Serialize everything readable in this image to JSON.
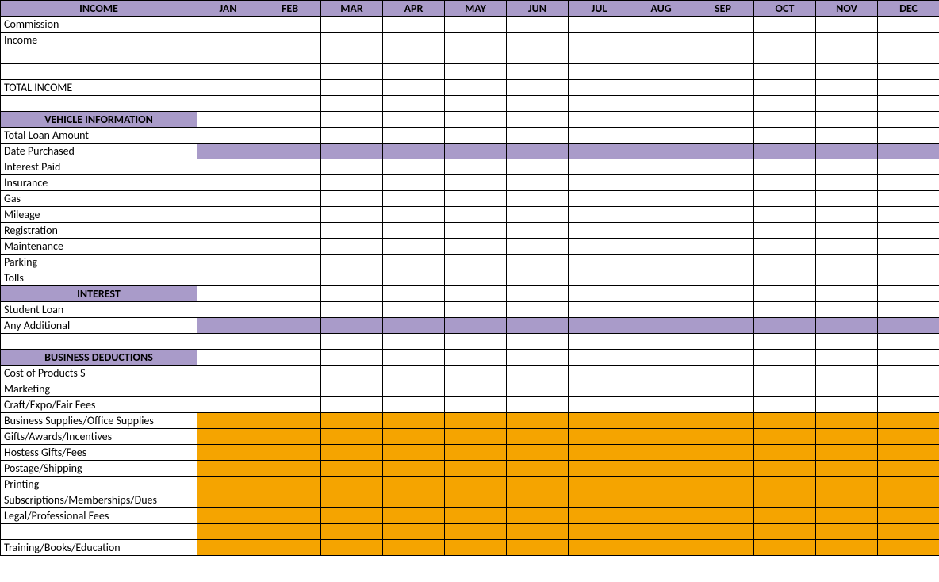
{
  "headers": {
    "label": "INCOME",
    "months": [
      "JAN",
      "FEB",
      "MAR",
      "APR",
      "MAY",
      "JUN",
      "JUL",
      "AUG",
      "SEP",
      "OCT",
      "NOV",
      "DEC"
    ]
  },
  "rows": [
    {
      "label": "Commission",
      "style": ""
    },
    {
      "label": "Income",
      "style": ""
    },
    {
      "label": "",
      "style": ""
    },
    {
      "label": "",
      "style": ""
    },
    {
      "label": "TOTAL INCOME",
      "style": ""
    },
    {
      "label": "",
      "style": ""
    },
    {
      "label": "VEHICLE INFORMATION",
      "style": "section"
    },
    {
      "label": "Total Loan Amount",
      "style": ""
    },
    {
      "label": "Date Purchased",
      "style": "purple"
    },
    {
      "label": "Interest Paid",
      "style": ""
    },
    {
      "label": "Insurance",
      "style": ""
    },
    {
      "label": "Gas",
      "style": ""
    },
    {
      "label": "Mileage",
      "style": ""
    },
    {
      "label": "Registration",
      "style": ""
    },
    {
      "label": "Maintenance",
      "style": ""
    },
    {
      "label": "Parking",
      "style": ""
    },
    {
      "label": "Tolls",
      "style": ""
    },
    {
      "label": "INTEREST",
      "style": "section"
    },
    {
      "label": "Student Loan",
      "style": ""
    },
    {
      "label": "Any Additional",
      "style": "purple"
    },
    {
      "label": "",
      "style": ""
    },
    {
      "label": "BUSINESS DEDUCTIONS",
      "style": "section"
    },
    {
      "label": "Cost of Products S",
      "style": ""
    },
    {
      "label": "Marketing",
      "style": ""
    },
    {
      "label": "Craft/Expo/Fair Fees",
      "style": ""
    },
    {
      "label": "Business Supplies/Office Supplies",
      "style": "orange"
    },
    {
      "label": "Gifts/Awards/Incentives",
      "style": "orange"
    },
    {
      "label": "Hostess Gifts/Fees",
      "style": "orange"
    },
    {
      "label": "Postage/Shipping",
      "style": "orange"
    },
    {
      "label": "Printing",
      "style": "orange"
    },
    {
      "label": "Subscriptions/Memberships/Dues",
      "style": "orange"
    },
    {
      "label": "Legal/Professional Fees",
      "style": "orange"
    },
    {
      "label": "",
      "style": "orange"
    },
    {
      "label": "Training/Books/Education",
      "style": "orange"
    }
  ]
}
